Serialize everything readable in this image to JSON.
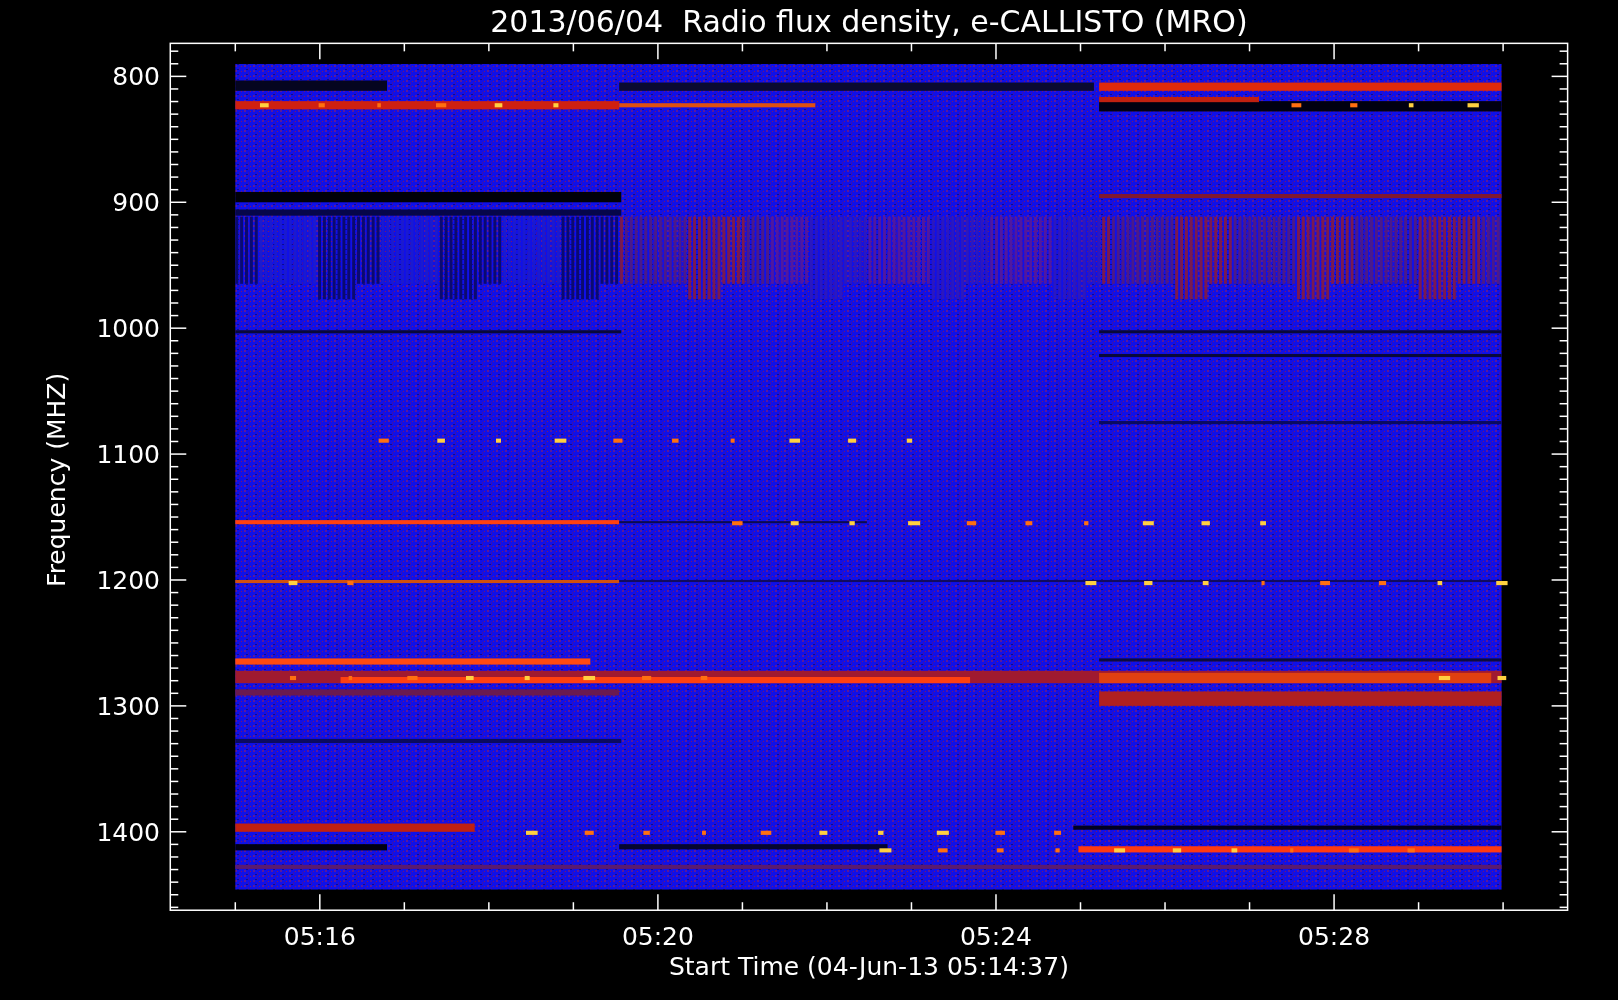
{
  "title": "2013/06/04  Radio flux density, e-CALLISTO (MRO)",
  "y_axis": {
    "title": "Frequency (MHZ)",
    "ticks": [
      "800",
      "900",
      "1000",
      "1100",
      "1200",
      "1300",
      "1400"
    ]
  },
  "x_axis": {
    "title": "Start Time (04-Jun-13 05:14:37)",
    "ticks": [
      "05:16",
      "05:20",
      "05:24",
      "05:28"
    ]
  }
}
